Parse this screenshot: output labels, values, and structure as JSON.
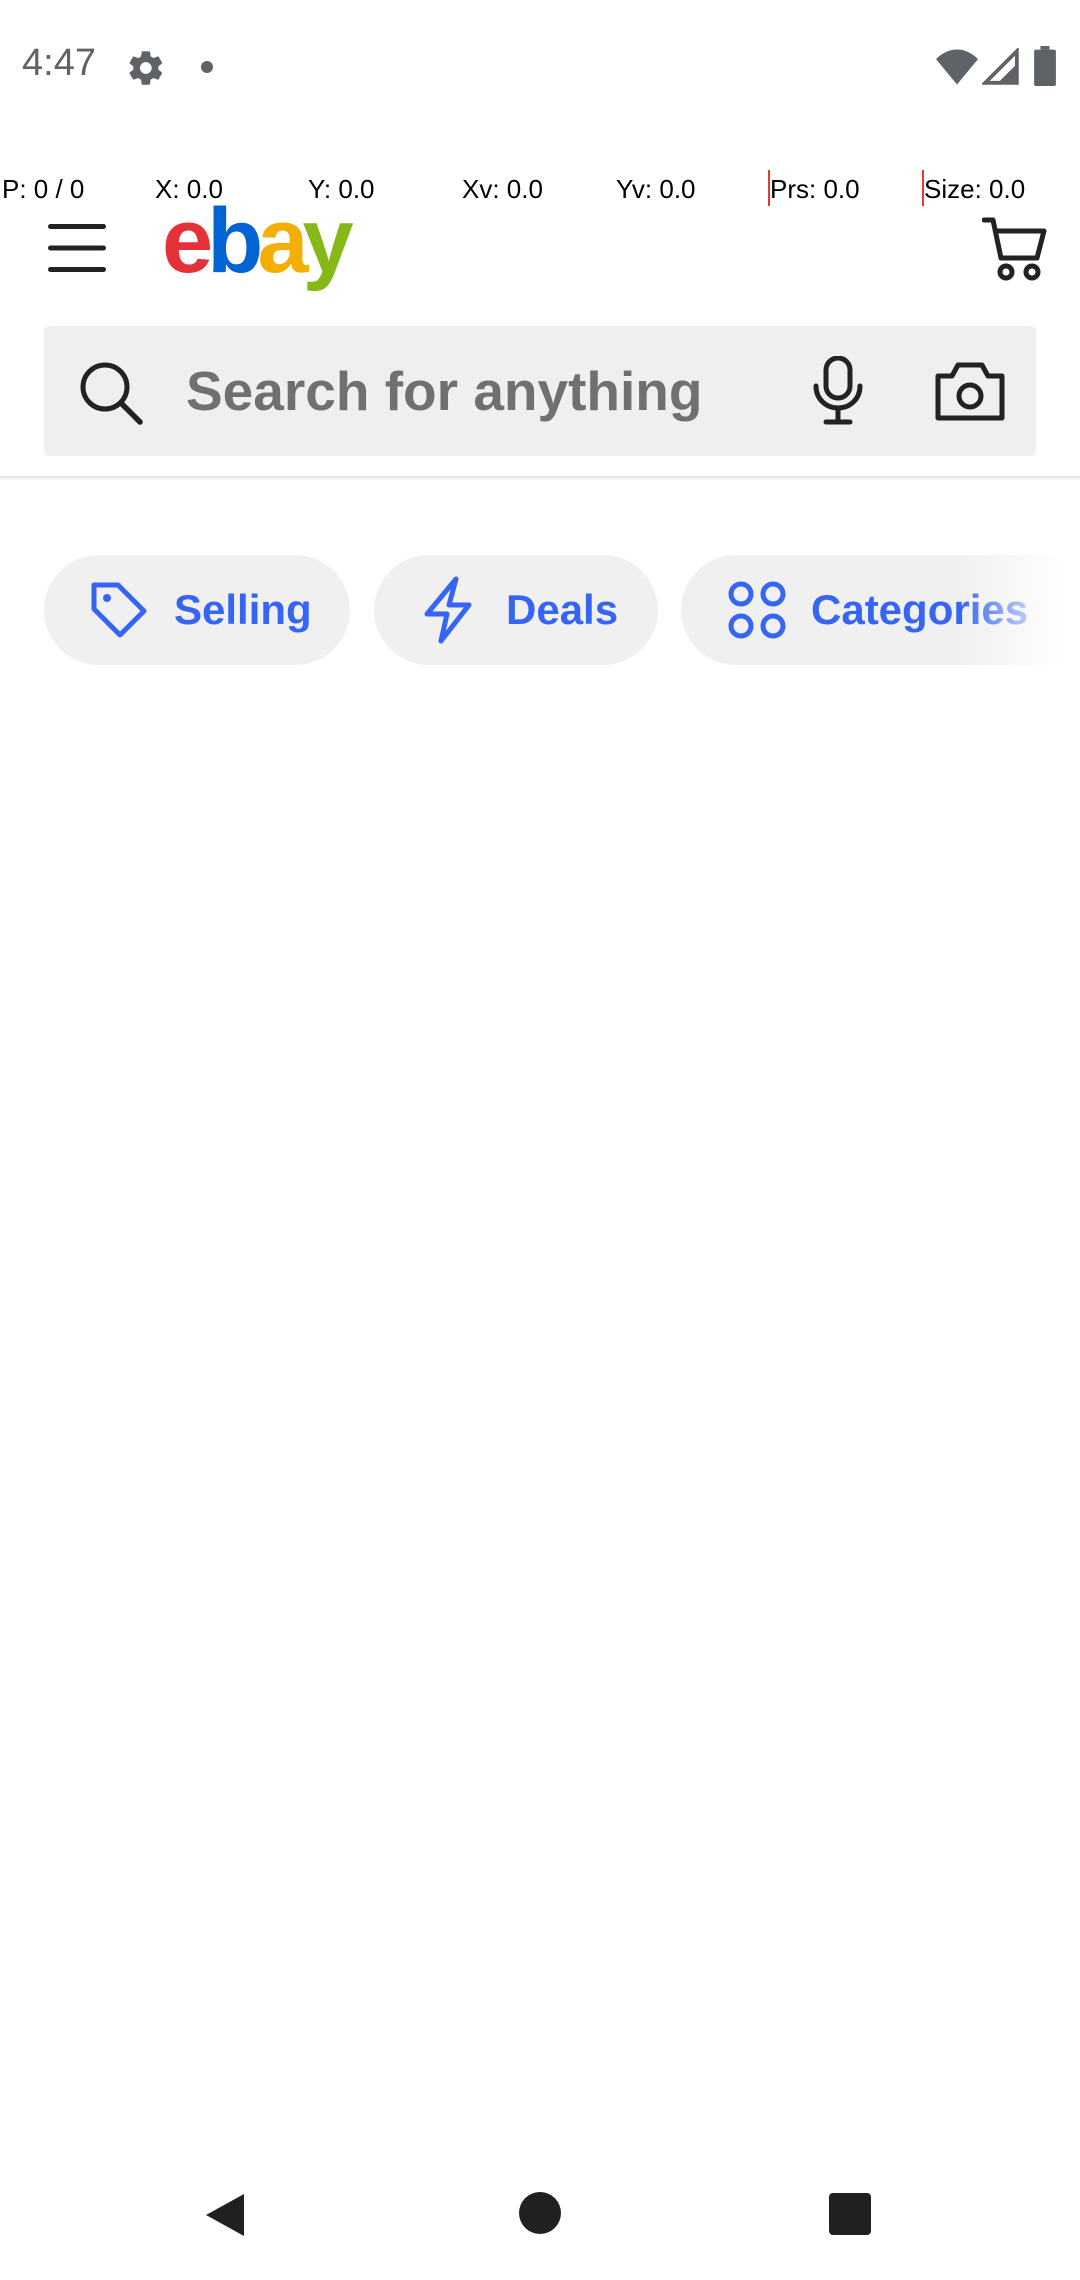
{
  "status_bar": {
    "time": "4:47"
  },
  "debug_overlay": {
    "pointer": "P: 0 / 0",
    "x": "X: 0.0",
    "y": "Y: 0.0",
    "xv": "Xv: 0.0",
    "yv": "Yv: 0.0",
    "pressure": "Prs: 0.0",
    "size": "Size: 0.0"
  },
  "header": {
    "logo_letters": [
      "e",
      "b",
      "a",
      "y"
    ],
    "logo_colors": [
      "#e53238",
      "#0064d2",
      "#f5af02",
      "#86b817"
    ],
    "menu_icon": "hamburger-menu-icon",
    "cart_icon": "shopping-cart-icon"
  },
  "search": {
    "placeholder": "Search for anything",
    "search_icon": "search-icon",
    "voice_icon": "microphone-icon",
    "camera_icon": "camera-icon"
  },
  "quick_links": [
    {
      "label": "Selling",
      "icon": "tag-icon"
    },
    {
      "label": "Deals",
      "icon": "lightning-bolt-icon"
    },
    {
      "label": "Categories",
      "icon": "grid-circles-icon"
    }
  ],
  "colors": {
    "accent": "#3665f3",
    "search_background": "#efefef",
    "pill_background": "#f0f0f0"
  },
  "nav_bar": {
    "back_icon": "back-triangle-icon",
    "home_icon": "home-circle-icon",
    "recents_icon": "recents-square-icon"
  }
}
